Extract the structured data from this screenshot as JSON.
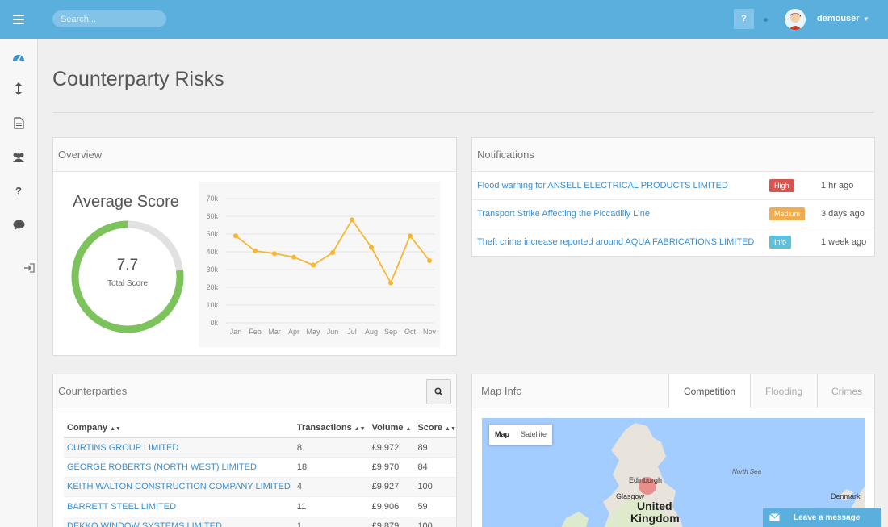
{
  "topbar": {
    "search_placeholder": "Search...",
    "help_label": "?",
    "username": "demouser"
  },
  "sidebar": {
    "items": [
      "dashboard-icon",
      "transfer-icon",
      "document-icon",
      "users-icon",
      "help-icon",
      "chat-icon",
      "logout-icon"
    ]
  },
  "page": {
    "title": "Counterparty Risks"
  },
  "overview": {
    "heading": "Overview",
    "avg_title": "Average Score",
    "score": "7.7",
    "score_label": "Total Score",
    "score_fraction": 0.77
  },
  "chart_data": {
    "type": "line",
    "categories": [
      "Jan",
      "Feb",
      "Mar",
      "Apr",
      "May",
      "Jun",
      "Jul",
      "Aug",
      "Sep",
      "Oct",
      "Nov"
    ],
    "series": [
      {
        "values": [
          49000,
          40500,
          39000,
          37000,
          32500,
          39500,
          58000,
          42500,
          22500,
          49000,
          35000
        ]
      }
    ],
    "yticks": [
      "0k",
      "10k",
      "20k",
      "30k",
      "40k",
      "50k",
      "60k",
      "70k"
    ],
    "ylim": [
      0,
      70000
    ],
    "grid": true,
    "color": "#f7b733"
  },
  "notifications": {
    "heading": "Notifications",
    "items": [
      {
        "text": "Flood warning for ANSELL ELECTRICAL PRODUCTS LIMITED",
        "badge": "High",
        "badge_color": "#d9534f",
        "time": "1 hr ago"
      },
      {
        "text": "Transport Strike Affecting the Piccadilly Line",
        "badge": "Medium",
        "badge_color": "#f0ad4e",
        "time": "3 days ago"
      },
      {
        "text": "Theft crime increase reported around AQUA FABRICATIONS LIMITED",
        "badge": "Info",
        "badge_color": "#5bc0de",
        "time": "1 week ago"
      }
    ]
  },
  "counterparties": {
    "heading": "Counterparties",
    "columns": [
      "Company",
      "Transactions",
      "Volume",
      "Score"
    ],
    "rows": [
      [
        "CURTINS GROUP LIMITED",
        "8",
        "£9,972",
        "89"
      ],
      [
        "GEORGE ROBERTS (NORTH WEST) LIMITED",
        "18",
        "£9,970",
        "84"
      ],
      [
        "KEITH WALTON CONSTRUCTION COMPANY LIMITED",
        "4",
        "£9,927",
        "100"
      ],
      [
        "BARRETT STEEL LIMITED",
        "11",
        "£9,906",
        "59"
      ],
      [
        "DEKKO WINDOW SYSTEMS LIMITED",
        "1",
        "£9,879",
        "100"
      ]
    ]
  },
  "map_info": {
    "heading": "Map Info",
    "tabs": [
      "Competition",
      "Flooding",
      "Crimes"
    ],
    "map_toggle": [
      "Map",
      "Satellite"
    ],
    "labels": [
      "Edinburgh",
      "Glasgow",
      "North Sea",
      "Denmark",
      "United",
      "Kingdom"
    ]
  },
  "chat": {
    "label": "Leave a message"
  },
  "colors": {
    "accent": "#5aafdc",
    "link": "#3c8fcf",
    "score_green": "#7dc35b"
  }
}
